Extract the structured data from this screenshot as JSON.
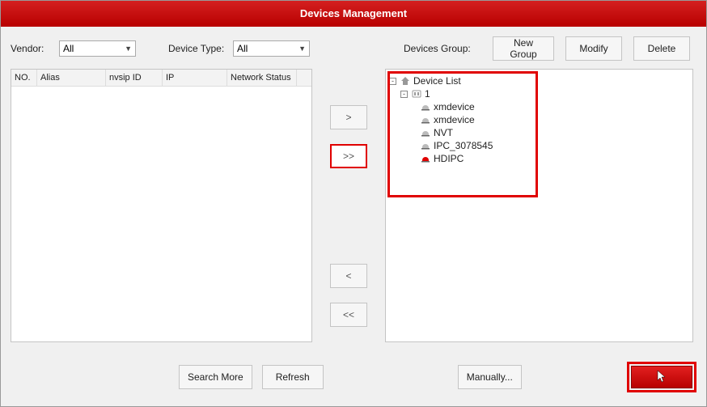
{
  "title": "Devices Management",
  "filters": {
    "vendor_label": "Vendor:",
    "vendor_value": "All",
    "device_type_label": "Device Type:",
    "device_type_value": "All"
  },
  "group_panel": {
    "label": "Devices Group:",
    "new_group": "New Group",
    "modify": "Modify",
    "delete": "Delete"
  },
  "table": {
    "columns": {
      "no": "NO.",
      "alias": "Alias",
      "nvsip": "nvsip ID",
      "ip": "IP",
      "net": "Network Status"
    },
    "rows": []
  },
  "move_buttons": {
    "add_one": ">",
    "add_all": ">>",
    "remove_one": "<",
    "remove_all": "<<"
  },
  "tree": {
    "root_label": "Device List",
    "group_label": "1",
    "devices": [
      {
        "label": "xmdevice",
        "red": false
      },
      {
        "label": "xmdevice",
        "red": false
      },
      {
        "label": "NVT",
        "red": false
      },
      {
        "label": "IPC_3078545",
        "red": false
      },
      {
        "label": "HDIPC",
        "red": true
      }
    ]
  },
  "footer": {
    "search_more": "Search More",
    "refresh": "Refresh",
    "manually": "Manually..."
  }
}
